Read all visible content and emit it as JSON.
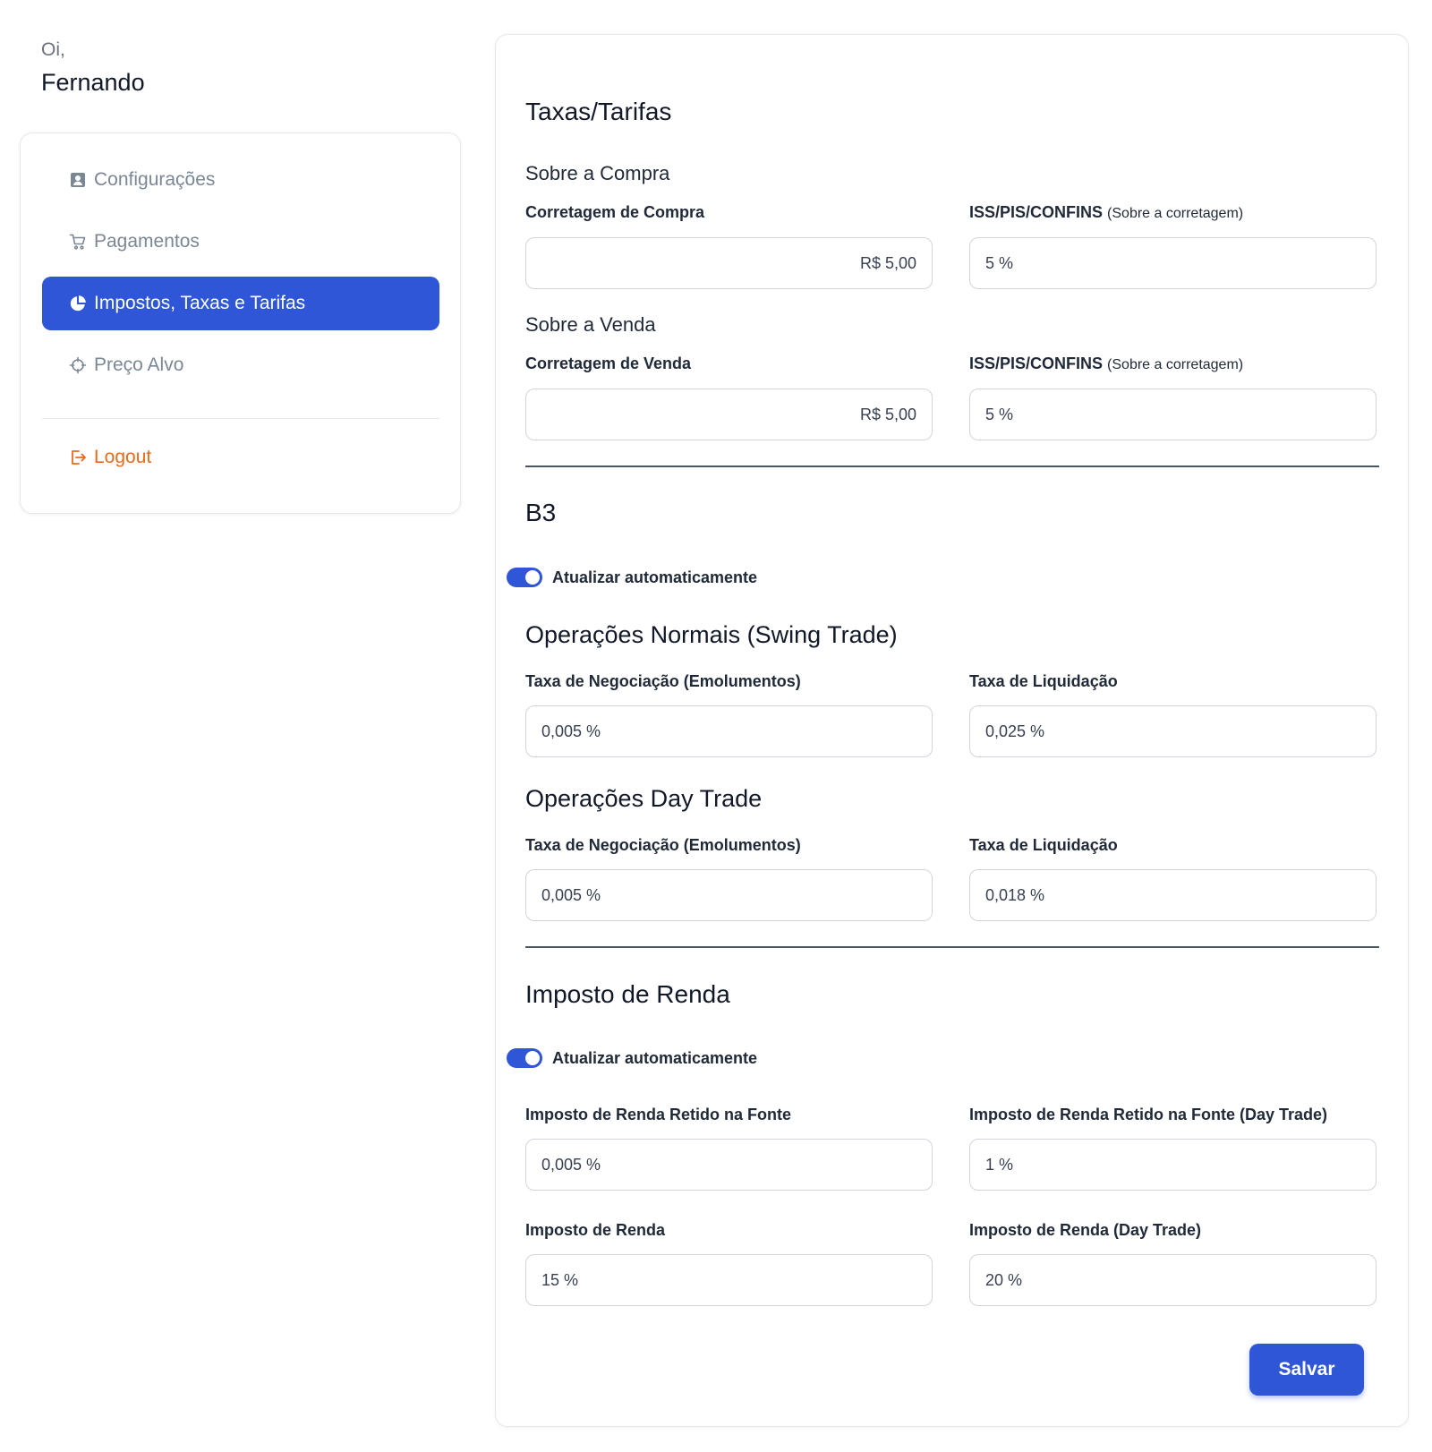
{
  "greeting": {
    "hi": "Oi,",
    "name": "Fernando"
  },
  "sidebar": {
    "items": [
      {
        "label": "Configurações",
        "icon": "user-card-icon"
      },
      {
        "label": "Pagamentos",
        "icon": "cart-icon"
      },
      {
        "label": "Impostos, Taxas e Tarifas",
        "icon": "pie-chart-icon",
        "active": true
      },
      {
        "label": "Preço Alvo",
        "icon": "crosshair-icon"
      }
    ],
    "logout": {
      "label": "Logout",
      "icon": "logout-icon"
    }
  },
  "taxas": {
    "title": "Taxas/Tarifas",
    "compra": {
      "title": "Sobre a Compra",
      "corretagem_label": "Corretagem de Compra",
      "corretagem_value": "R$ 5,00",
      "iss_label": "ISS/PIS/CONFINS",
      "iss_note": "(Sobre a corretagem)",
      "iss_value": "5 %"
    },
    "venda": {
      "title": "Sobre a Venda",
      "corretagem_label": "Corretagem de Venda",
      "corretagem_value": "R$ 5,00",
      "iss_label": "ISS/PIS/CONFINS",
      "iss_note": "(Sobre a corretagem)",
      "iss_value": "5 %"
    }
  },
  "b3": {
    "title": "B3",
    "auto_update_label": "Atualizar automaticamente",
    "auto_update_on": true,
    "swing": {
      "title": "Operações Normais (Swing Trade)",
      "negociacao_label": "Taxa de Negociação (Emolumentos)",
      "negociacao_value": "0,005 %",
      "liquidacao_label": "Taxa de Liquidação",
      "liquidacao_value": "0,025 %"
    },
    "day": {
      "title": "Operações Day Trade",
      "negociacao_label": "Taxa de Negociação (Emolumentos)",
      "negociacao_value": "0,005 %",
      "liquidacao_label": "Taxa de Liquidação",
      "liquidacao_value": "0,018 %"
    }
  },
  "ir": {
    "title": "Imposto de Renda",
    "auto_update_label": "Atualizar automaticamente",
    "auto_update_on": true,
    "retido_label": "Imposto de Renda Retido na Fonte",
    "retido_value": "0,005 %",
    "retido_dt_label": "Imposto de Renda Retido na Fonte (Day Trade)",
    "retido_dt_value": "1 %",
    "renda_label": "Imposto de Renda",
    "renda_value": "15 %",
    "renda_dt_label": "Imposto de Renda (Day Trade)",
    "renda_dt_value": "20 %"
  },
  "actions": {
    "save_label": "Salvar"
  },
  "colors": {
    "accent": "#2f56d6",
    "logout": "#ea6a1b",
    "muted": "#7b8794"
  }
}
